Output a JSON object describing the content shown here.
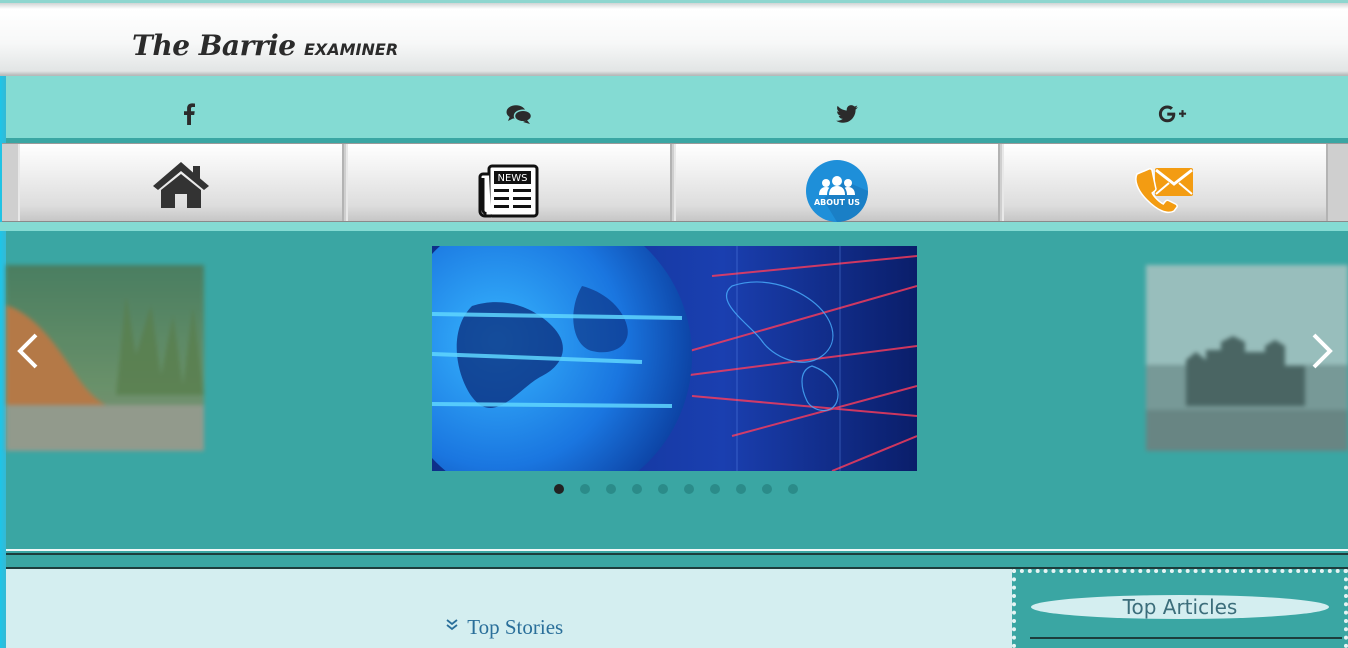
{
  "header": {
    "logo_script": "The Barrie",
    "logo_caps": "EXAMINER"
  },
  "social": {
    "icons": [
      "facebook-icon",
      "chat-icon",
      "twitter-icon",
      "google-plus-icon"
    ]
  },
  "nav": {
    "items": [
      {
        "name": "home",
        "icon": "home-icon"
      },
      {
        "name": "news",
        "icon": "newspaper-icon",
        "label": "NEWS"
      },
      {
        "name": "about-us",
        "icon": "about-us-icon",
        "label": "ABOUT US"
      },
      {
        "name": "contact",
        "icon": "contact-phone-mail-icon"
      }
    ]
  },
  "carousel": {
    "slide_count": 10,
    "active_index": 0
  },
  "content": {
    "top_stories": "Top Stories"
  },
  "sidebar": {
    "top_articles": "Top Articles"
  },
  "colors": {
    "teal": "#3aa6a3",
    "light_teal": "#84dbd3",
    "content_bg": "#d4eef0",
    "link": "#2a6f9a"
  }
}
